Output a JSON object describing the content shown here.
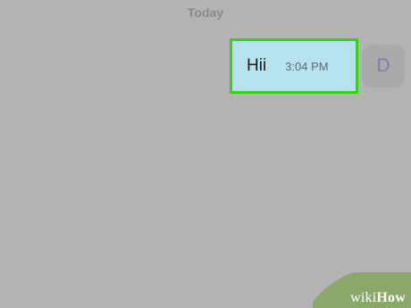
{
  "conversation": {
    "date_label": "Today"
  },
  "message": {
    "text": "Hii",
    "time": "3:04 PM"
  },
  "contact": {
    "avatar_initial": "D"
  },
  "watermark": {
    "prefix": "wiki",
    "suffix": "How"
  },
  "colors": {
    "background": "#b3b3b3",
    "bubble": "#b7e2ef",
    "highlight": "#36d116"
  }
}
